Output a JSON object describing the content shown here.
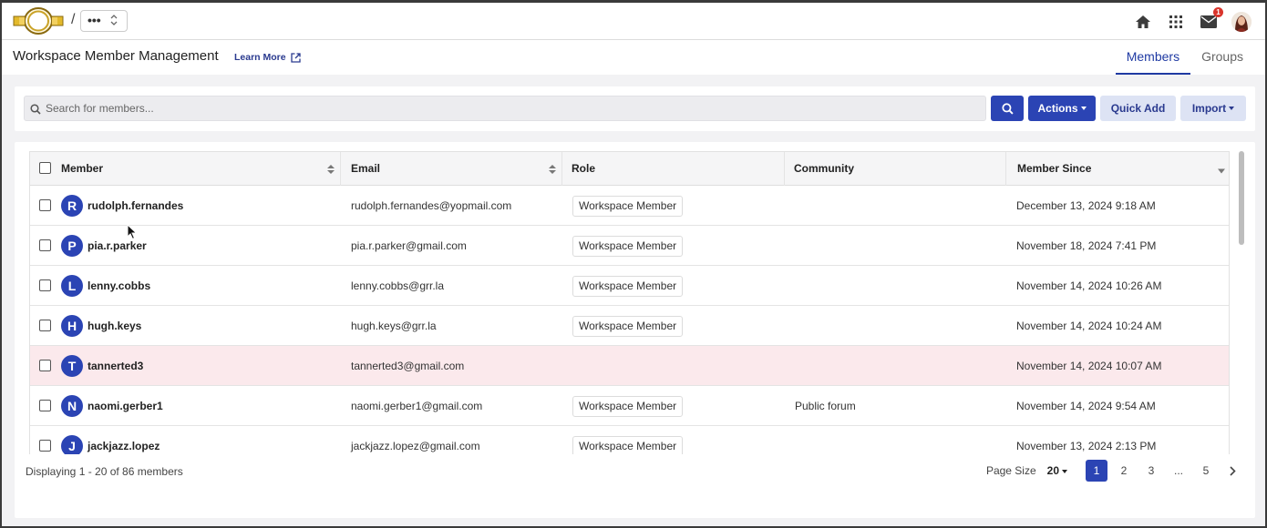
{
  "topbar": {
    "breadcrumb_sep": "/",
    "breadcrumb_more": "•••",
    "notification_count": "1",
    "icons": [
      "home-icon",
      "apps-grid-icon",
      "mail-icon",
      "user-avatar"
    ]
  },
  "header": {
    "title": "Workspace Member Management",
    "learn_more": "Learn More",
    "tabs": [
      {
        "label": "Members",
        "active": true
      },
      {
        "label": "Groups",
        "active": false
      }
    ]
  },
  "search": {
    "placeholder": "Search for members...",
    "actions_label": "Actions",
    "quick_add_label": "Quick Add",
    "import_label": "Import"
  },
  "table": {
    "columns": [
      "Member",
      "Email",
      "Role",
      "Community",
      "Member Since"
    ],
    "rows": [
      {
        "initial": "R",
        "name": "rudolph.fernandes",
        "email": "rudolph.fernandes@yopmail.com",
        "role": "Workspace Member",
        "community": "",
        "since": "December 13, 2024 9:18 AM"
      },
      {
        "initial": "P",
        "name": "pia.r.parker",
        "email": "pia.r.parker@gmail.com",
        "role": "Workspace Member",
        "community": "",
        "since": "November 18, 2024 7:41 PM"
      },
      {
        "initial": "L",
        "name": "lenny.cobbs",
        "email": "lenny.cobbs@grr.la",
        "role": "Workspace Member",
        "community": "",
        "since": "November 14, 2024 10:26 AM"
      },
      {
        "initial": "H",
        "name": "hugh.keys",
        "email": "hugh.keys@grr.la",
        "role": "Workspace Member",
        "community": "",
        "since": "November 14, 2024 10:24 AM"
      },
      {
        "initial": "T",
        "name": "tannerted3",
        "email": "tannerted3@gmail.com",
        "role": "",
        "community": "",
        "since": "November 14, 2024 10:07 AM"
      },
      {
        "initial": "N",
        "name": "naomi.gerber1",
        "email": "naomi.gerber1@gmail.com",
        "role": "Workspace Member",
        "community": "Public forum",
        "since": "November 14, 2024 9:54 AM"
      },
      {
        "initial": "J",
        "name": "jackjazz.lopez",
        "email": "jackjazz.lopez@gmail.com",
        "role": "Workspace Member",
        "community": "",
        "since": "November 13, 2024 2:13 PM"
      }
    ]
  },
  "footer": {
    "displaying": "Displaying 1 - 20 of 86 members",
    "page_size_label": "Page Size",
    "page_size_value": "20",
    "pages": [
      "1",
      "2",
      "3",
      "...",
      "5"
    ],
    "current_page": "1"
  },
  "colors": {
    "accent": "#2b44b4",
    "highlight_row": "#fbe9ec",
    "badge": "#d9342b"
  }
}
